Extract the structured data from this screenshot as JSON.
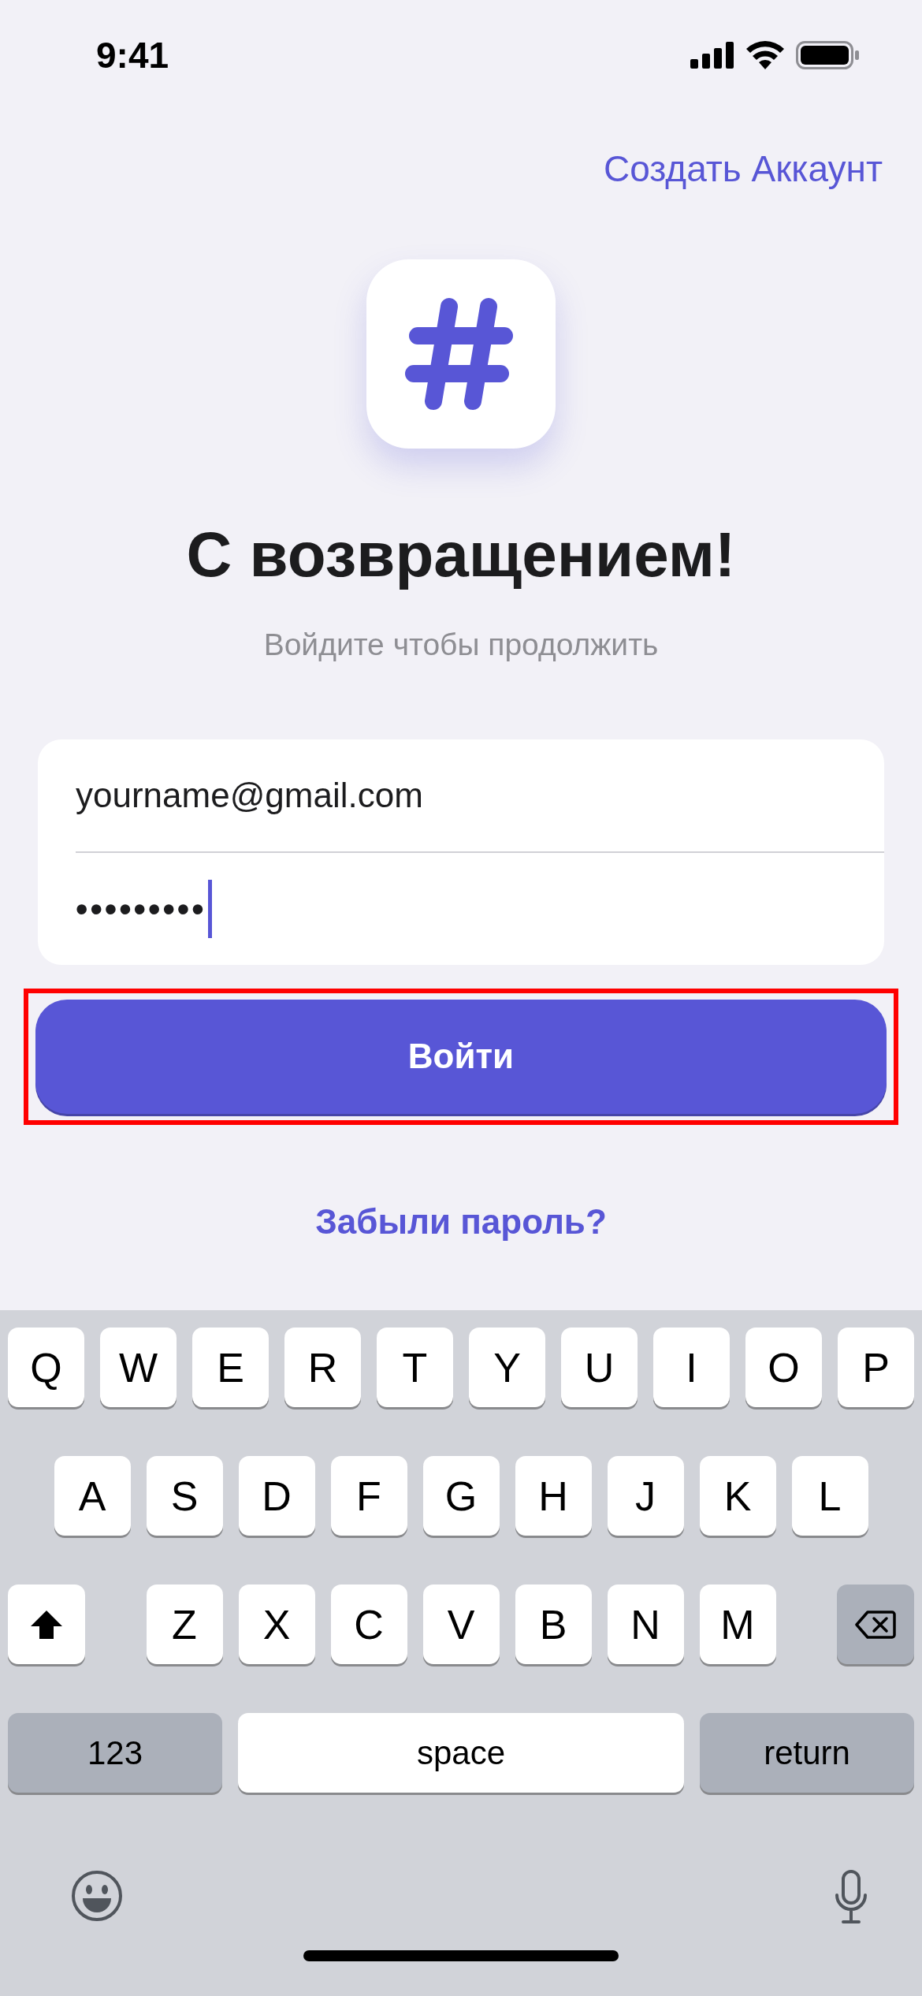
{
  "status_bar": {
    "time": "9:41"
  },
  "create_account": "Создать Аккаунт",
  "title": "С возвращением!",
  "subtitle": "Войдите чтобы продолжить",
  "email": {
    "value": "yourname@gmail.com"
  },
  "password": {
    "value": "•••••••••",
    "focused": true
  },
  "login_button": {
    "label": "Войти",
    "highlighted": true
  },
  "forgot_password": "Забыли пароль?",
  "keyboard": {
    "letter_rows": [
      [
        {
          "kind": "letter",
          "label": "Q"
        },
        {
          "kind": "letter",
          "label": "W"
        },
        {
          "kind": "letter",
          "label": "E"
        },
        {
          "kind": "letter",
          "label": "R"
        },
        {
          "kind": "letter",
          "label": "T"
        },
        {
          "kind": "letter",
          "label": "Y"
        },
        {
          "kind": "letter",
          "label": "U"
        },
        {
          "kind": "letter",
          "label": "I"
        },
        {
          "kind": "letter",
          "label": "O"
        },
        {
          "kind": "letter",
          "label": "P"
        }
      ],
      [
        {
          "kind": "letter",
          "label": "A"
        },
        {
          "kind": "letter",
          "label": "S"
        },
        {
          "kind": "letter",
          "label": "D"
        },
        {
          "kind": "letter",
          "label": "F"
        },
        {
          "kind": "letter",
          "label": "G"
        },
        {
          "kind": "letter",
          "label": "H"
        },
        {
          "kind": "letter",
          "label": "J"
        },
        {
          "kind": "letter",
          "label": "K"
        },
        {
          "kind": "letter",
          "label": "L"
        }
      ],
      [
        {
          "kind": "shift"
        },
        {
          "kind": "letter",
          "label": "Z"
        },
        {
          "kind": "letter",
          "label": "X"
        },
        {
          "kind": "letter",
          "label": "C"
        },
        {
          "kind": "letter",
          "label": "V"
        },
        {
          "kind": "letter",
          "label": "B"
        },
        {
          "kind": "letter",
          "label": "N"
        },
        {
          "kind": "letter",
          "label": "M"
        },
        {
          "kind": "backspace"
        }
      ]
    ],
    "bottom_row": {
      "numbers_key": "123",
      "space_key": "space",
      "return_key": "return"
    }
  }
}
